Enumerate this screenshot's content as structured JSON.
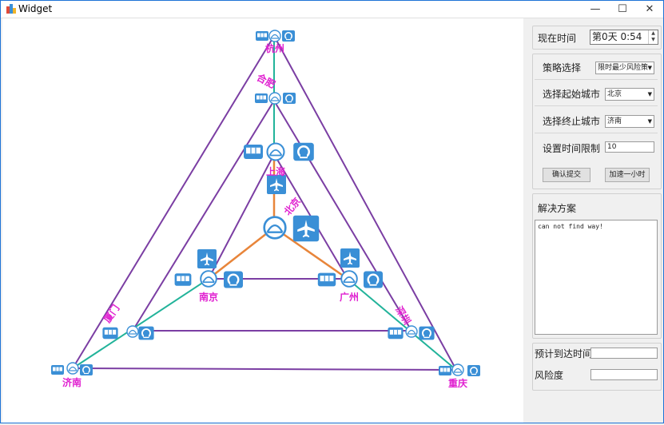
{
  "window": {
    "title": "Widget",
    "minimize": "—",
    "maximize": "☐",
    "close": "✕"
  },
  "map": {
    "cities": {
      "hangzhou": "杭州",
      "hefei": "合肥",
      "shanghai": "上海",
      "beijing": "北京",
      "nanjing": "南京",
      "guangzhou": "广州",
      "xiamen": "厦门",
      "shenzhen": "深圳",
      "jinan": "济南",
      "chongqing": "重庆"
    },
    "colors": {
      "outer_edge": "#7b3ea3",
      "rail_edge": "#22b39a",
      "air_edge": "#e8853a",
      "city_label": "#e020d0",
      "icon_blue": "#3a8fd6"
    },
    "icons": [
      "bus-icon",
      "train-icon",
      "plane-icon",
      "station-icon"
    ]
  },
  "side": {
    "current_time_label": "现在时间",
    "current_time_value": "第0天  0:54",
    "strategy_label": "策略选择",
    "strategy_value": "限时最少风险策",
    "start_city_label": "选择起始城市",
    "start_city_value": "北京",
    "end_city_label": "选择终止城市",
    "end_city_value": "济南",
    "time_limit_label": "设置时间限制",
    "time_limit_value": "10",
    "confirm_button": "确认提交",
    "speedup_button": "加速一小时",
    "solution_label": "解决方案",
    "solution_text": "can not find way!",
    "eta_label": "预计到达时间",
    "eta_value": "",
    "risk_label": "风险度",
    "risk_value": ""
  }
}
